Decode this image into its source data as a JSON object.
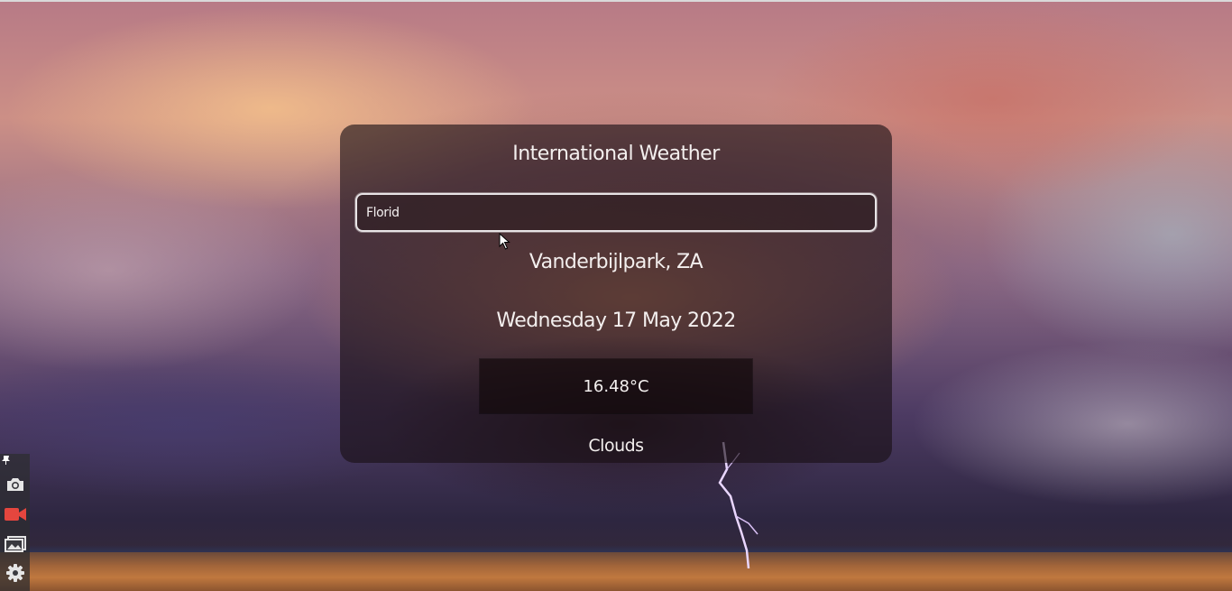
{
  "app": {
    "title": "International Weather"
  },
  "search": {
    "value": "Florid",
    "placeholder": ""
  },
  "weather": {
    "location": "Vanderbijlpark, ZA",
    "date": "Wednesday 17 May 2022",
    "temperature": "16.48°C",
    "conditions": "Clouds"
  },
  "toolbar": {
    "tools": [
      "pin-icon",
      "camera-icon",
      "video-camera-icon",
      "gallery-icon",
      "gear-icon"
    ]
  },
  "colors": {
    "card_background": "#190f14",
    "text": "#f3efee",
    "search_border": "#e8e4e6",
    "record_red": "#e5463e"
  }
}
